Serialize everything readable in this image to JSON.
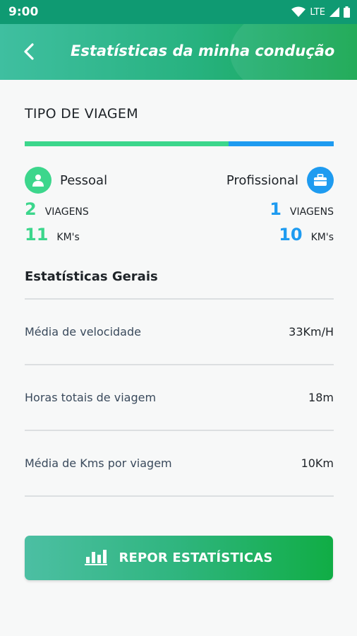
{
  "status_bar": {
    "time": "9:00",
    "network": "LTE",
    "icons": [
      "wifi-icon",
      "signal-icon",
      "battery-icon"
    ]
  },
  "app_bar": {
    "title": "Estatísticas da minha condução",
    "back_icon": "chevron-left-icon"
  },
  "trip_type": {
    "title": "TIPO DE VIAGEM",
    "personal_share": 0.66,
    "colors": {
      "personal": "#3cd68c",
      "professional": "#1e9bf0"
    },
    "personal": {
      "label": "Pessoal",
      "icon": "person-icon",
      "trips_value": "2",
      "trips_unit": "VIAGENS",
      "km_value": "11",
      "km_unit": "KM's"
    },
    "professional": {
      "label": "Profissional",
      "icon": "briefcase-icon",
      "trips_value": "1",
      "trips_unit": "VIAGENS",
      "km_value": "10",
      "km_unit": "KM's"
    }
  },
  "general": {
    "title": "Estatísticas Gerais",
    "rows": [
      {
        "label": "Média de velocidade",
        "value": "33Km/H"
      },
      {
        "label": "Horas totais de viagem",
        "value": "18m"
      },
      {
        "label": "Média de Kms por viagem",
        "value": "10Km"
      }
    ]
  },
  "reset_button": {
    "label": "REPOR ESTATÍSTICAS",
    "icon": "bar-chart-icon"
  }
}
